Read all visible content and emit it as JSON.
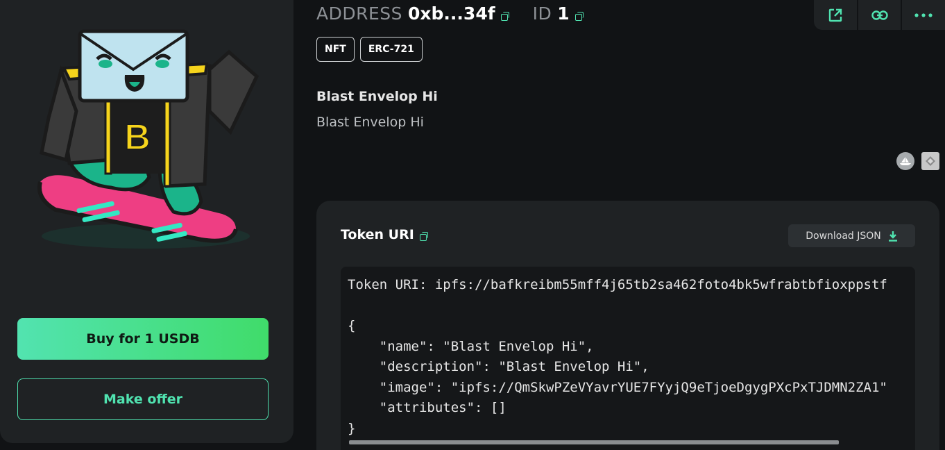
{
  "header": {
    "address_label": "ADDRESS",
    "address_value": "0xb...34f",
    "id_label": "ID",
    "id_value": "1"
  },
  "toolbar": {
    "icons": [
      "external-link-icon",
      "link-icon",
      "more-icon"
    ]
  },
  "tags": [
    "NFT",
    "ERC-721"
  ],
  "token": {
    "name": "Blast Envelop Hi",
    "description": "Blast Envelop Hi"
  },
  "actions": {
    "buy_label": "Buy for 1 USDB",
    "offer_label": "Make offer"
  },
  "uri_section": {
    "title": "Token URI",
    "download_label": "Download JSON",
    "code": "Token URI: ipfs://bafkreibm55mff4j65tb2sa462foto4bk5wfrabtbfioxppstf\n\n{\n    \"name\": \"Blast Envelop Hi\",\n    \"description\": \"Blast Envelop Hi\",\n    \"image\": \"ipfs://QmSkwPZeVYavrYUE7FYyjQ9eTjoeDgygPXcPxTJDMN2ZA1\"\n    \"attributes\": []\n}"
  },
  "colors": {
    "accent": "#50e3b0",
    "buy_gradient_start": "#52e3b0",
    "buy_gradient_end": "#40dc6a",
    "card_bg": "#1f2224",
    "page_bg": "#111315"
  }
}
